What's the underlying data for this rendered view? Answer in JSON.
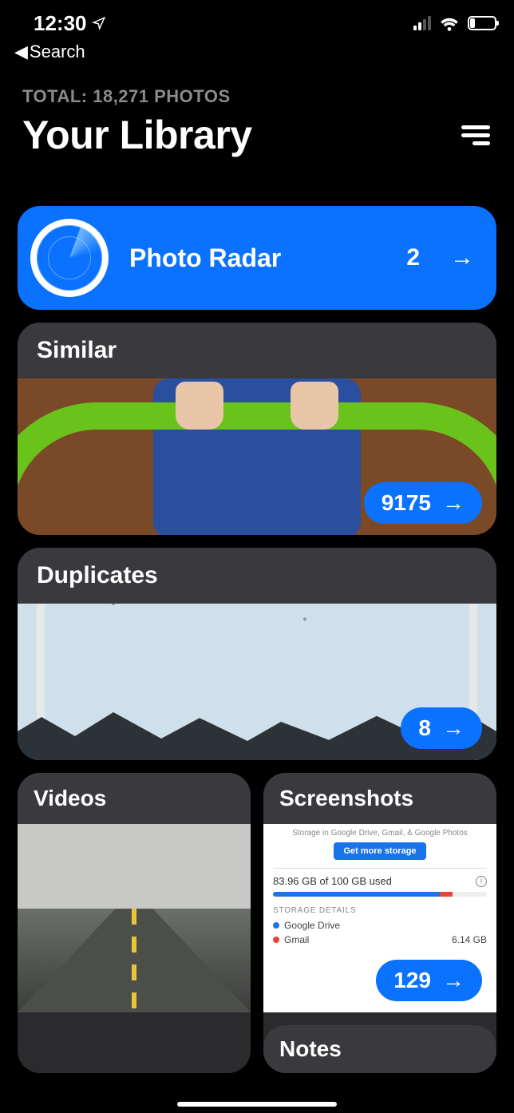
{
  "status": {
    "time": "12:30",
    "back_label": "Search"
  },
  "header": {
    "total_line": "TOTAL: 18,271 PHOTOS",
    "title": "Your Library"
  },
  "radar": {
    "title": "Photo Radar",
    "count": "2"
  },
  "similar": {
    "label": "Similar",
    "count": "9175"
  },
  "duplicates": {
    "label": "Duplicates",
    "count": "8"
  },
  "videos": {
    "label": "Videos"
  },
  "screenshots": {
    "label": "Screenshots",
    "count": "129",
    "caption": "Storage in Google Drive, Gmail, & Google Photos",
    "button": "Get more storage",
    "used": "83.96 GB of 100 GB used",
    "details_heading": "STORAGE DETAILS",
    "item1_name": "Google Drive",
    "item2_name": "Gmail",
    "item2_size": "6.14 GB"
  },
  "notes": {
    "label": "Notes"
  }
}
